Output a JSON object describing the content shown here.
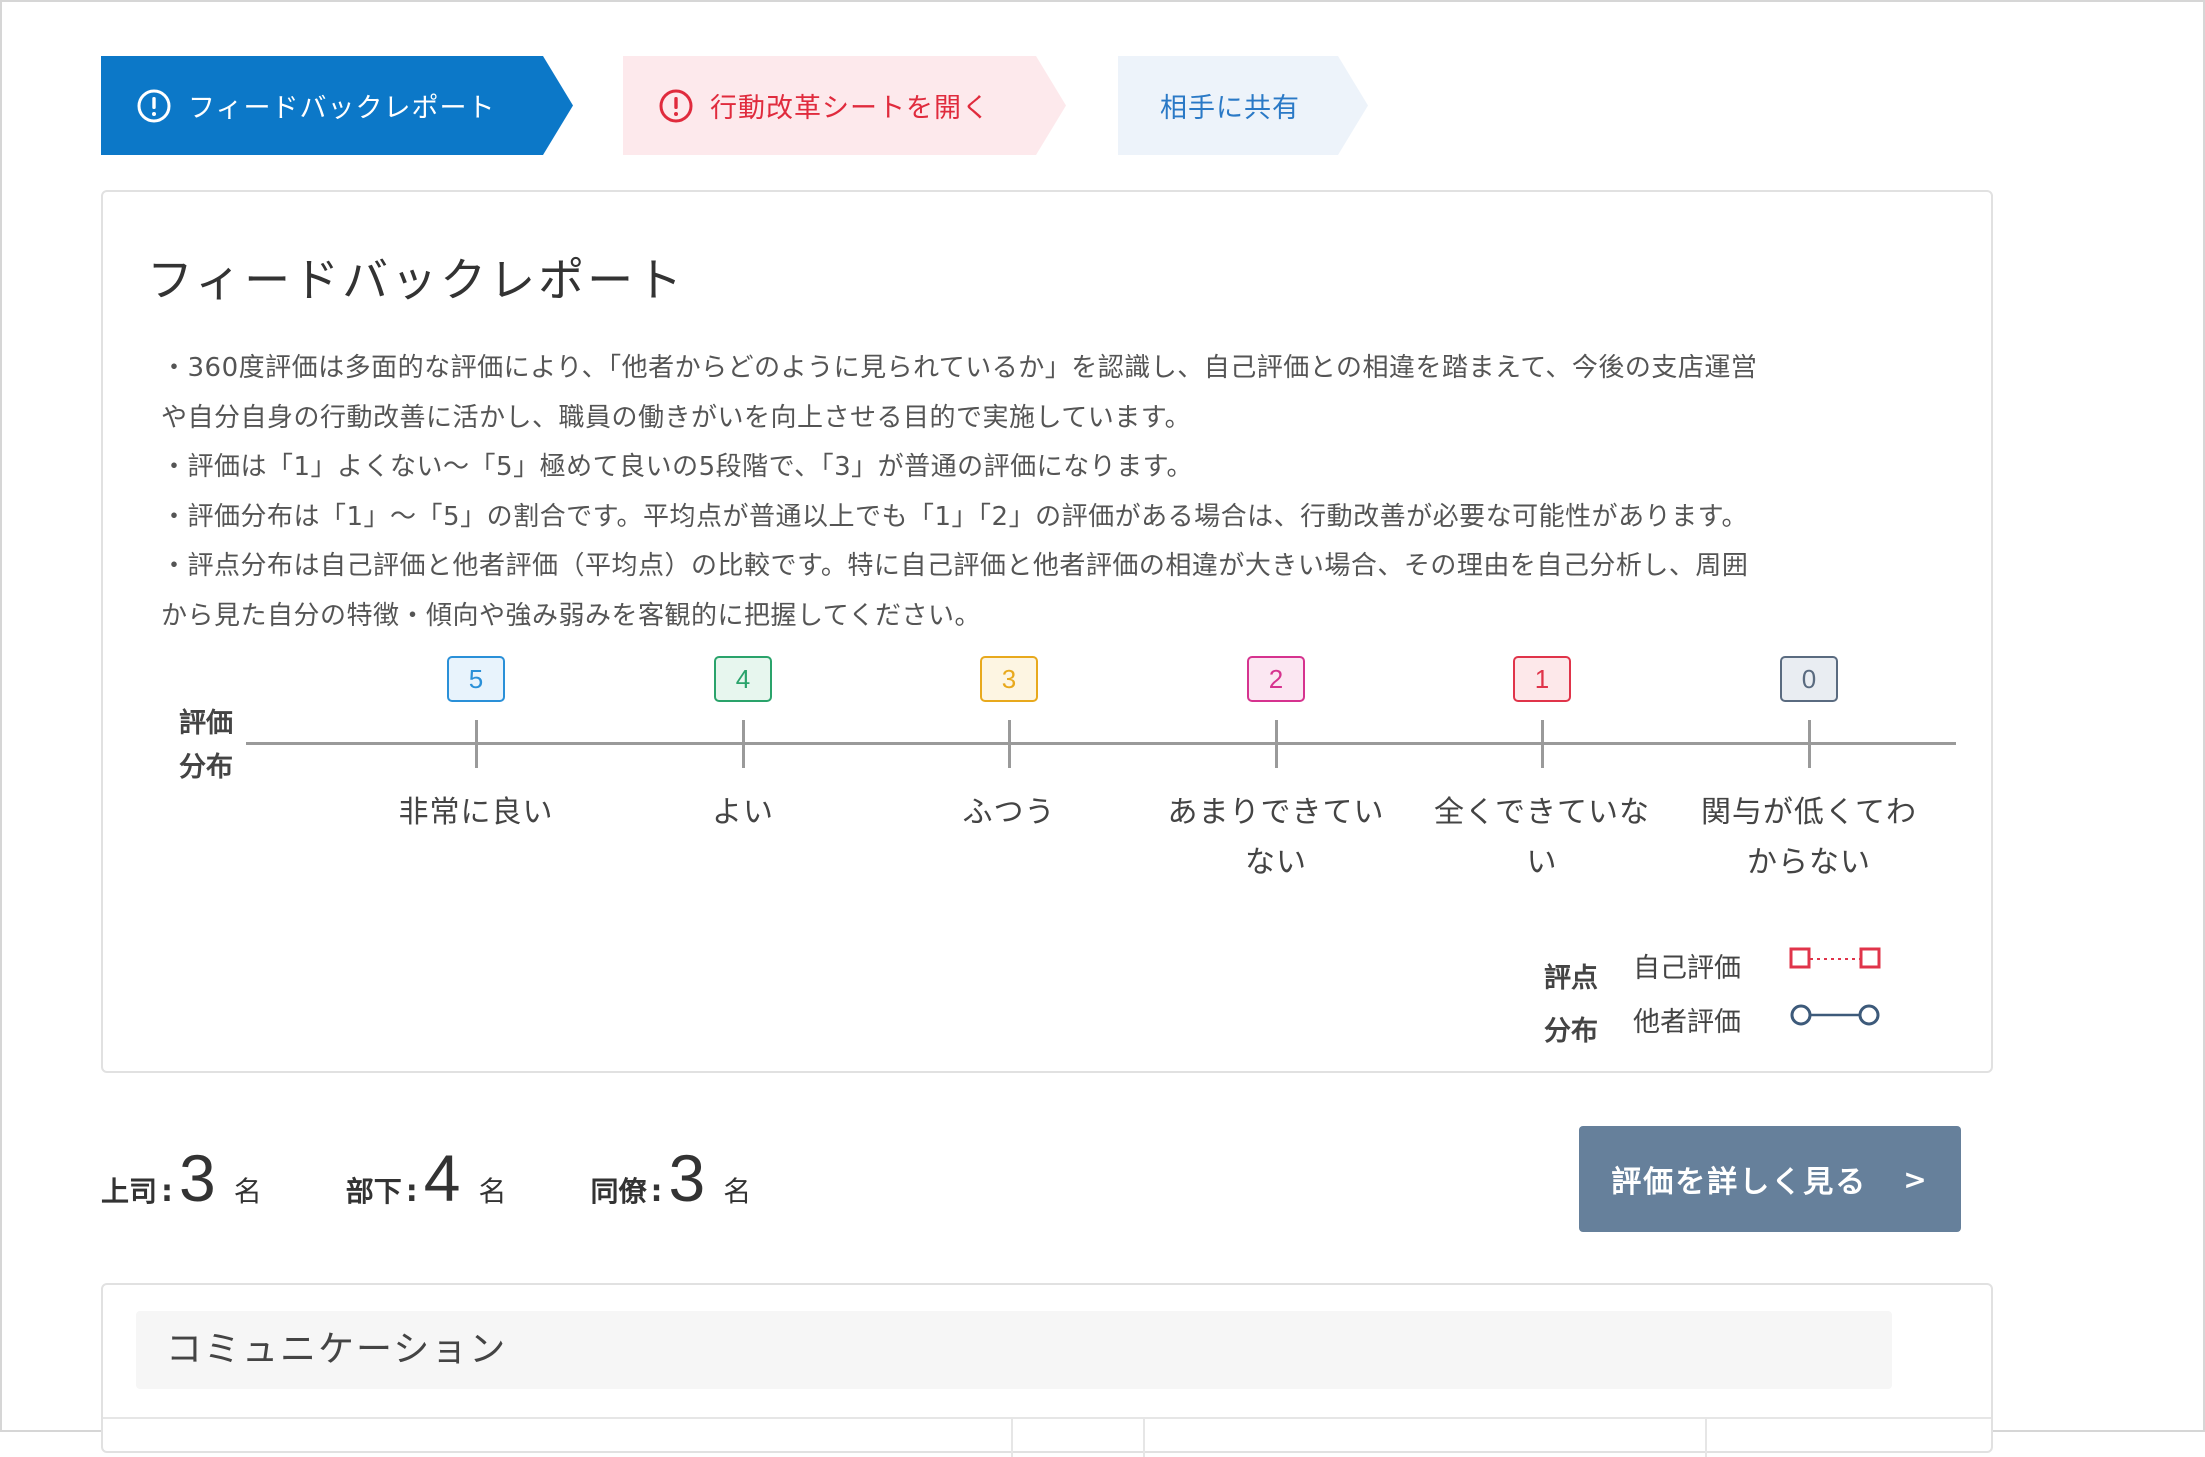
{
  "steps": [
    {
      "label": "フィードバックレポート",
      "icon": "alert-circle-icon",
      "color": "#0c78c8"
    },
    {
      "label": "行動改革シートを開く",
      "icon": "alert-circle-icon",
      "color": "#e02b3d"
    },
    {
      "label": "相手に共有",
      "color": "#2a79c6"
    }
  ],
  "report": {
    "title": "フィードバックレポート",
    "description": [
      "・360度評価は多面的な評価により、「他者からどのように見られているか」を認識し、自己評価との相違を踏まえて、今後の支店運営",
      "や自分自身の行動改善に活かし、職員の働きがいを向上させる目的で実施しています。",
      "・評価は「1」よくない〜「5」極めて良いの5段階で、「3」が普通の評価になります。",
      "・評価分布は「1」〜「5」の割合です。平均点が普通以上でも「1」「2」の評価がある場合は、行動改善が必要な可能性があります。",
      "・評点分布は自己評価と他者評価（平均点）の比較です。特に自己評価と他者評価の相違が大きい場合、その理由を自己分析し、周囲",
      "から見た自分の特徴・傾向や強み弱みを客観的に把握してください。"
    ],
    "scale_label_line1": "評価",
    "scale_label_line2": "分布",
    "scale": [
      {
        "value": "5",
        "label_line1": "非常に良い",
        "label_line2": "",
        "color": "#2a90d8",
        "bg": "#e8f3fc"
      },
      {
        "value": "4",
        "label_line1": "よい",
        "label_line2": "",
        "color": "#2aa36b",
        "bg": "#e7f6ee"
      },
      {
        "value": "3",
        "label_line1": "ふつう",
        "label_line2": "",
        "color": "#e8a91d",
        "bg": "#fdf5e2"
      },
      {
        "value": "2",
        "label_line1": "あまりできてい",
        "label_line2": "ない",
        "color": "#d6338f",
        "bg": "#fbe7f2"
      },
      {
        "value": "1",
        "label_line1": "全くできていな",
        "label_line2": "い",
        "color": "#e0344a",
        "bg": "#fde8ea"
      },
      {
        "value": "0",
        "label_line1": "関与が低くてわ",
        "label_line2": "からない",
        "color": "#5a6b80",
        "bg": "#e9edf2"
      }
    ],
    "legend": {
      "title_line1": "評点",
      "title_line2": "分布",
      "self_label": "自己評価",
      "self_color": "#e0344a",
      "others_label": "他者評価",
      "others_color": "#3d5a7a"
    }
  },
  "counts": [
    {
      "label": "上司",
      "value": "3",
      "unit": "名"
    },
    {
      "label": "部下",
      "value": "4",
      "unit": "名"
    },
    {
      "label": "同僚",
      "value": "3",
      "unit": "名"
    }
  ],
  "detail_button": {
    "label": "評価を詳しく見る",
    "arrow": ">"
  },
  "section": {
    "title": "コミュニケーション"
  }
}
